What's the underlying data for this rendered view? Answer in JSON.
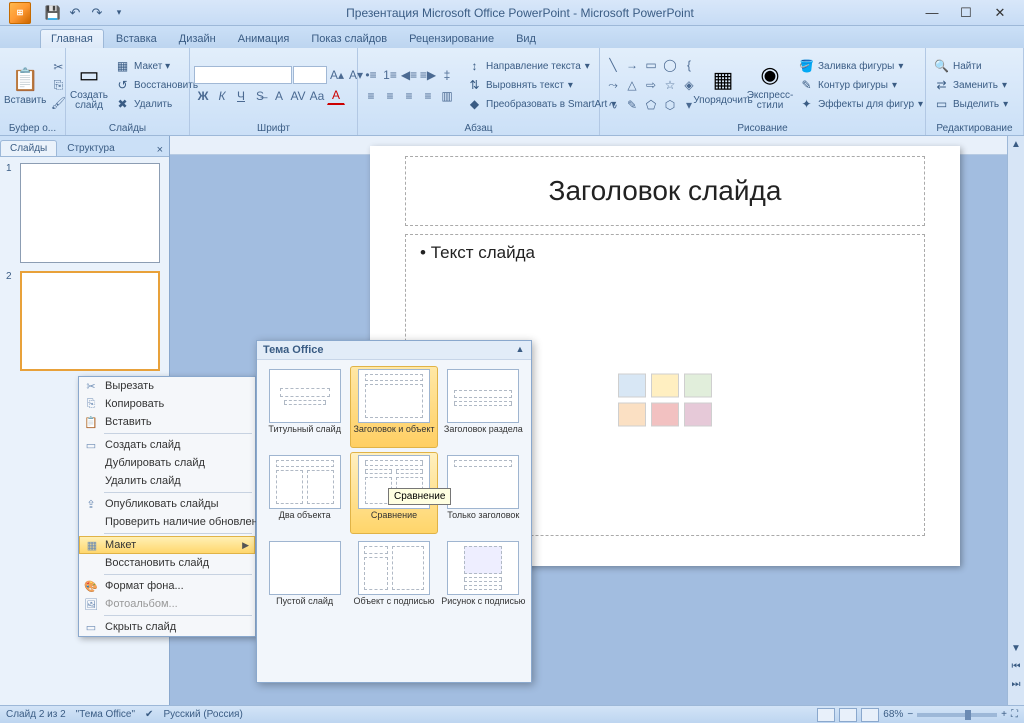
{
  "title": "Презентация Microsoft Office PowerPoint - Microsoft PowerPoint",
  "tabs": {
    "home": "Главная",
    "insert": "Вставка",
    "design": "Дизайн",
    "anim": "Анимация",
    "show": "Показ слайдов",
    "review": "Рецензирование",
    "view": "Вид"
  },
  "ribbon": {
    "clipboard": {
      "label": "Буфер о...",
      "paste": "Вставить"
    },
    "slides": {
      "label": "Слайды",
      "new": "Создать\nслайд",
      "layout": "Макет ▾",
      "reset": "Восстановить",
      "delete": "Удалить"
    },
    "font": {
      "label": "Шрифт"
    },
    "para": {
      "label": "Абзац",
      "textdir": "Направление текста",
      "align": "Выровнять текст",
      "smartart": "Преобразовать в SmartArt"
    },
    "drawing": {
      "label": "Рисование",
      "arrange": "Упорядочить",
      "quick": "Экспресс-стили",
      "fill": "Заливка фигуры",
      "outline": "Контур фигуры",
      "effects": "Эффекты для фигур"
    },
    "editing": {
      "label": "Редактирование",
      "find": "Найти",
      "replace": "Заменить",
      "select": "Выделить"
    }
  },
  "panel": {
    "slides": "Слайды",
    "outline": "Структура"
  },
  "slide": {
    "title": "Заголовок слайда",
    "body": "Текст слайда"
  },
  "context": {
    "cut": "Вырезать",
    "copy": "Копировать",
    "paste": "Вставить",
    "new": "Создать слайд",
    "dup": "Дублировать слайд",
    "del": "Удалить слайд",
    "pub": "Опубликовать слайды",
    "check": "Проверить наличие обновлений",
    "layout": "Макет",
    "reset": "Восстановить слайд",
    "format": "Формат фона...",
    "album": "Фотоальбом...",
    "hide": "Скрыть слайд"
  },
  "gallery": {
    "title": "Тема Office",
    "items": [
      "Титульный слайд",
      "Заголовок и объект",
      "Заголовок раздела",
      "Два объекта",
      "Сравнение",
      "Только заголовок",
      "Пустой слайд",
      "Объект с подписью",
      "Рисунок с подписью"
    ]
  },
  "tooltip": "Сравнение",
  "status": {
    "slide": "Слайд 2 из 2",
    "theme": "\"Тема Office\"",
    "lang": "Русский (Россия)",
    "zoom": "68%"
  }
}
